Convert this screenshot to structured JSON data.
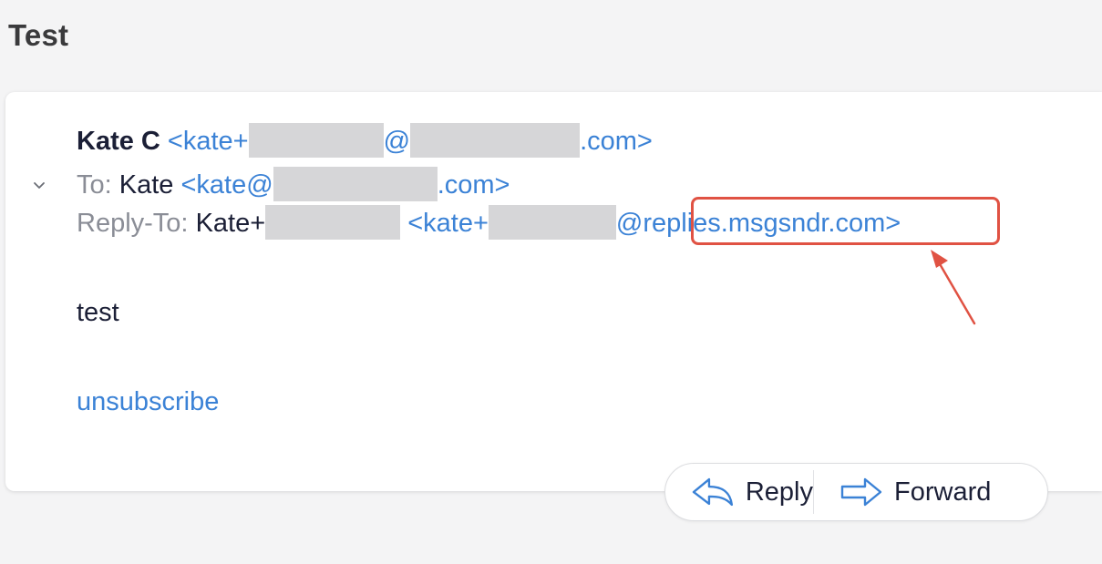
{
  "subject": "Test",
  "sender": {
    "name": "Kate C",
    "email_prefix": "<kate+",
    "email_at": "@",
    "email_suffix": ".com>"
  },
  "to": {
    "label": "To:",
    "name": "Kate",
    "email_prefix": "<kate@",
    "email_suffix": ".com>"
  },
  "reply_to": {
    "label": "Reply-To:",
    "name": "Kate+",
    "email_prefix": "<kate+",
    "email_domain": "@replies.msgsndr.com",
    "email_close": ">"
  },
  "body": {
    "text": "test",
    "unsubscribe_label": "unsubscribe"
  },
  "actions": {
    "reply_label": "Reply",
    "forward_label": "Forward"
  },
  "colors": {
    "link": "#3b82d6",
    "highlight": "#e05243",
    "redaction": "#d6d6d8"
  },
  "icons": [
    "chevron-down-icon",
    "reply-icon",
    "forward-icon",
    "annotation-arrow"
  ]
}
